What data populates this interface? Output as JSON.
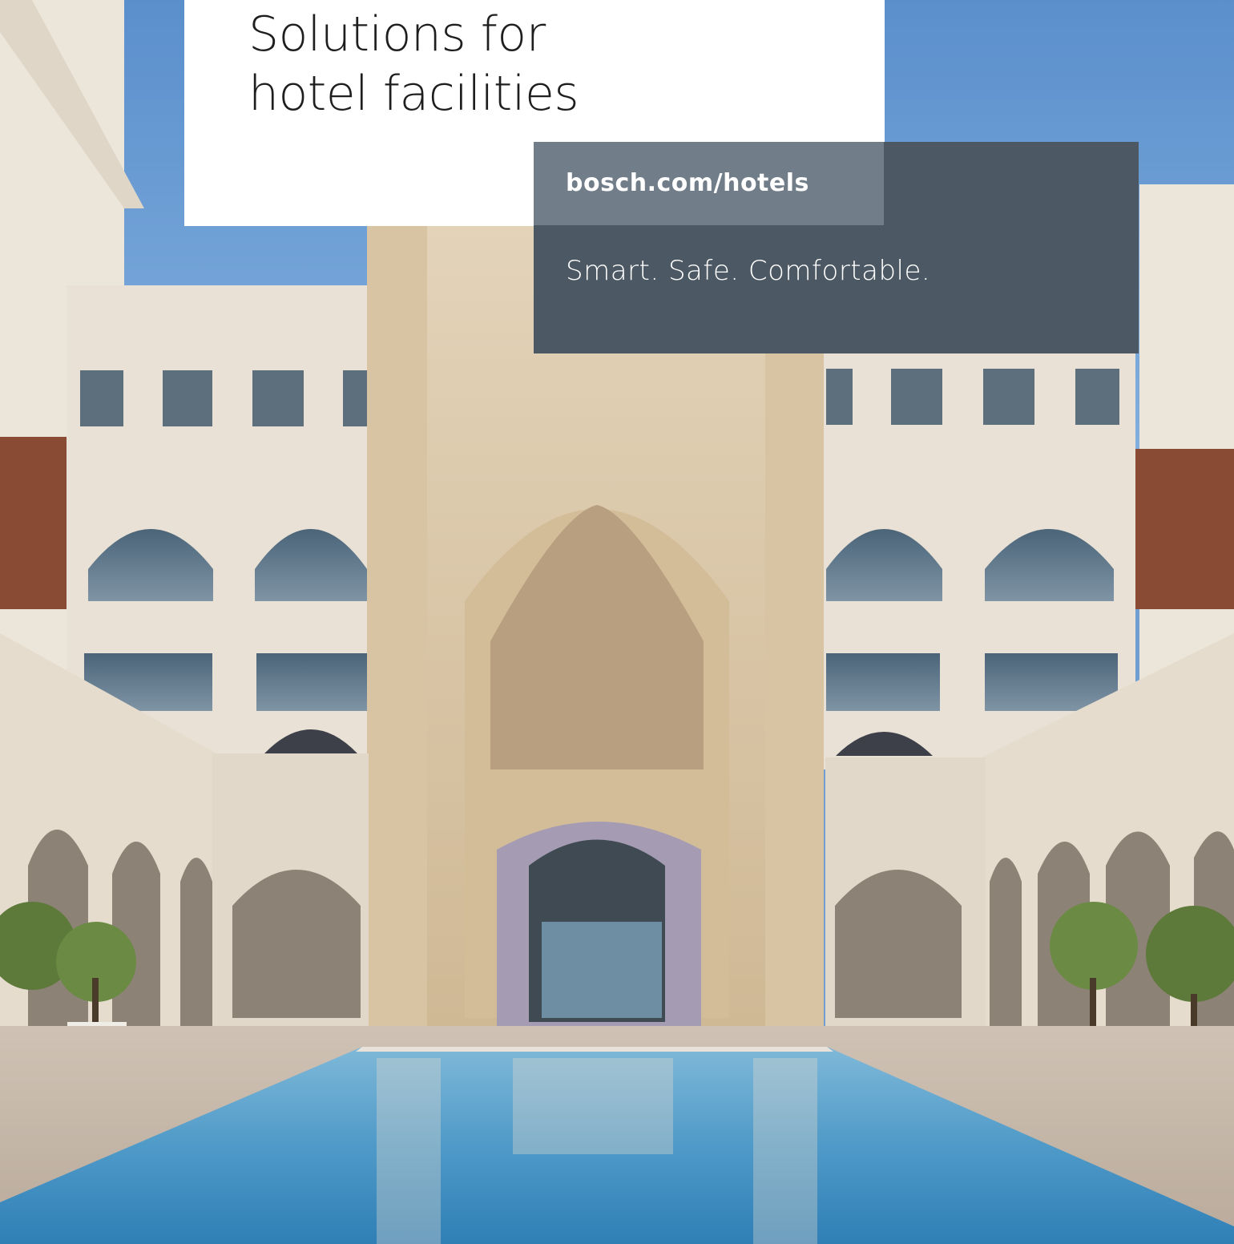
{
  "cover": {
    "title_line1": "Solutions for",
    "title_line2": "hotel facilities",
    "url": "bosch.com/hotels",
    "tagline": "Smart. Safe. Comfortable."
  },
  "photo": {
    "subject": "hotel-courtyard-photo"
  },
  "colors": {
    "title_panel": "#ffffff",
    "url_panel": "#717d88",
    "dark_panel": "#4c5964",
    "sky": "#6f9fd2",
    "stone": "#e6ddd0",
    "pool": "#5fa6cf"
  }
}
